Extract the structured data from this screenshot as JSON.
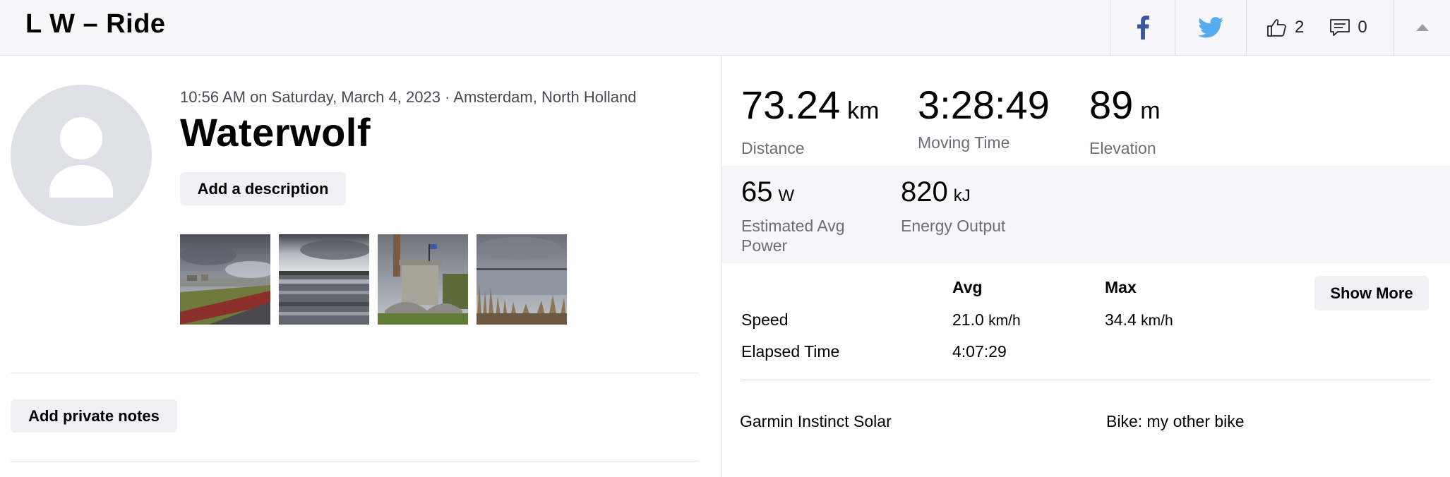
{
  "header": {
    "title": "L W – Ride",
    "kudos_count": "2",
    "comments_count": "0"
  },
  "activity": {
    "meta": "10:56 AM on Saturday, March 4, 2023 · Amsterdam, North Holland",
    "name": "Waterwolf",
    "add_description_label": "Add a description",
    "add_private_notes_label": "Add private notes",
    "photos": [
      "road-photo",
      "water-photo",
      "castle-photo",
      "lake-photo"
    ]
  },
  "stats": {
    "distance": {
      "value": "73.24",
      "unit": "km",
      "label": "Distance"
    },
    "moving_time": {
      "value": "3:28:49",
      "unit": "",
      "label": "Moving Time"
    },
    "elevation": {
      "value": "89",
      "unit": "m",
      "label": "Elevation"
    },
    "power": {
      "value": "65",
      "unit": "W",
      "label_line1": "Estimated Avg",
      "label_line2": "Power"
    },
    "energy": {
      "value": "820",
      "unit": "kJ",
      "label": "Energy Output"
    }
  },
  "table": {
    "col_avg": "Avg",
    "col_max": "Max",
    "show_more_label": "Show More",
    "rows": [
      {
        "label": "Speed",
        "avg": "21.0",
        "avg_unit": "km/h",
        "max": "34.4",
        "max_unit": "km/h"
      },
      {
        "label": "Elapsed Time",
        "avg": "4:07:29",
        "avg_unit": "",
        "max": "",
        "max_unit": ""
      }
    ]
  },
  "device": {
    "name": "Garmin Instinct Solar",
    "bike": "Bike: my other bike"
  },
  "colors": {
    "header_bg": "#f7f7fa",
    "facebook": "#3b5998",
    "twitter": "#55acee",
    "button_bg": "#f0f0f5"
  }
}
